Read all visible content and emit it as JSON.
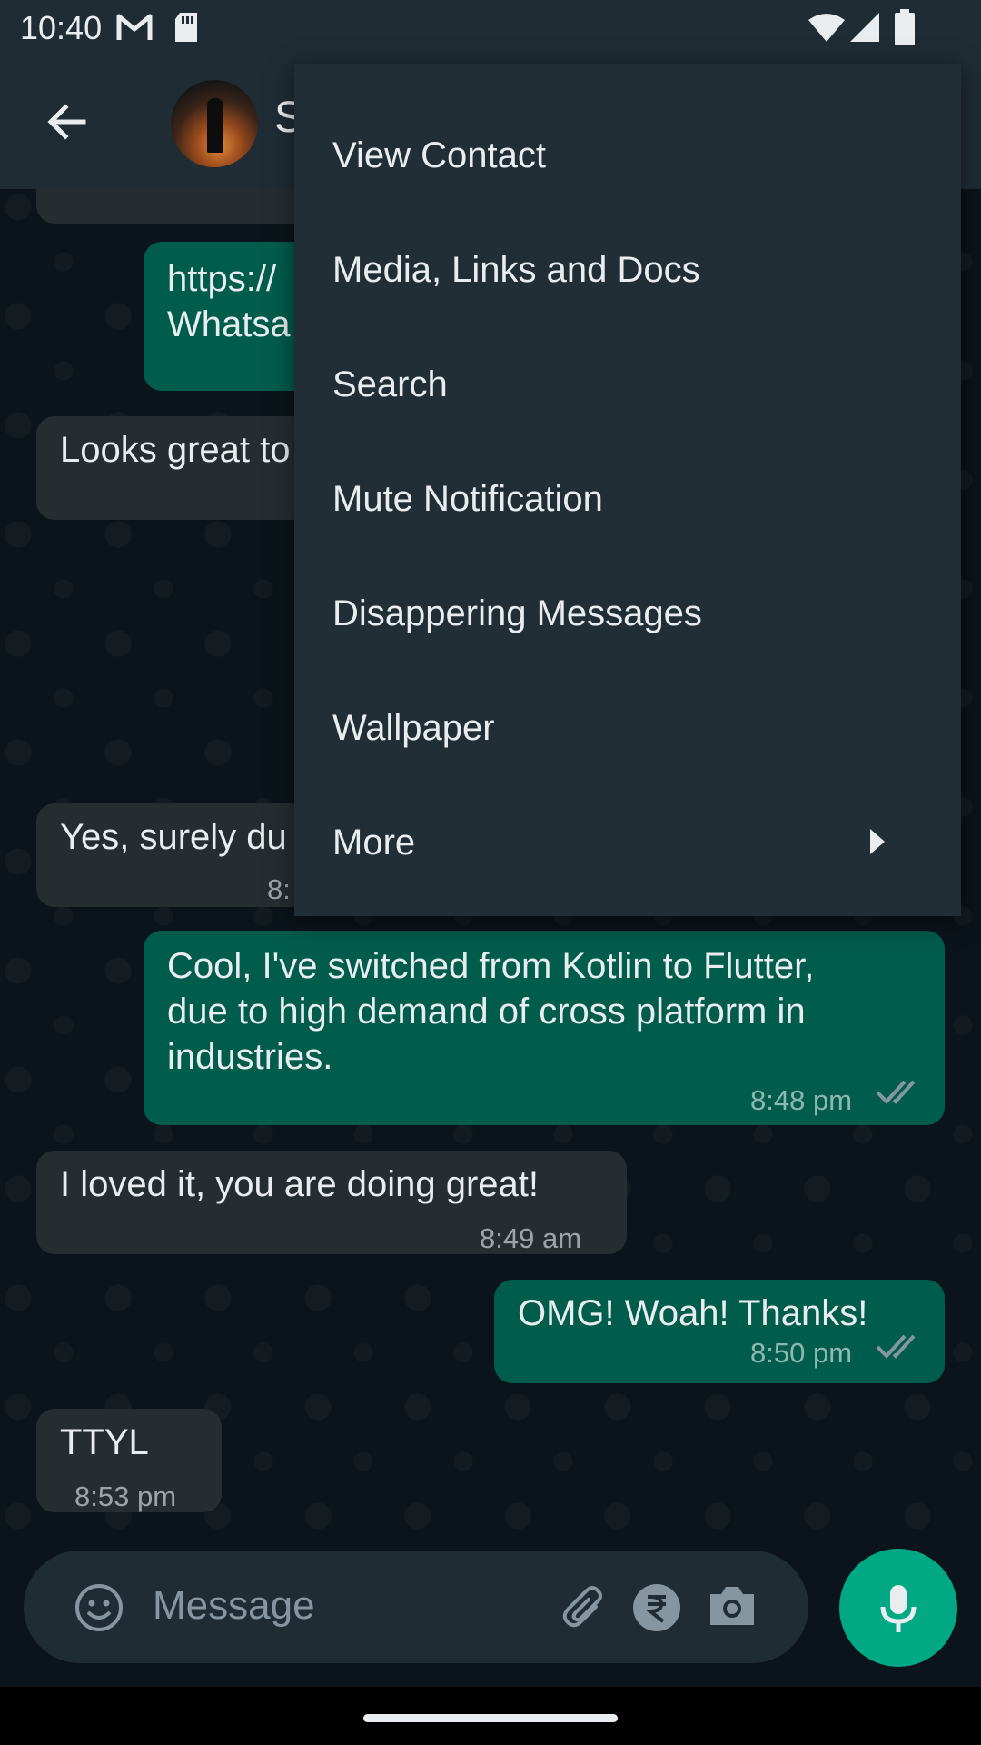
{
  "status_bar": {
    "time": "10:40"
  },
  "header": {
    "contact_name": "S"
  },
  "messages": [
    {
      "text": "https://",
      "text2": "Whatsa"
    },
    {
      "text": "Looks great to"
    },
    {
      "text": "Yes, surely du",
      "time": "8:"
    },
    {
      "text": "Cool, I've switched from Kotlin to Flutter,",
      "text2": "due to high demand of cross platform in",
      "text3": "industries.",
      "time": "8:48 pm"
    },
    {
      "text": "I loved it, you are doing great!",
      "time": "8:49 am"
    },
    {
      "text": "OMG! Woah! Thanks!",
      "time": "8:50 pm"
    },
    {
      "text": "TTYL",
      "time": "8:53 pm"
    }
  ],
  "menu": {
    "items": [
      {
        "label": "View Contact"
      },
      {
        "label": "Media, Links and Docs"
      },
      {
        "label": "Search"
      },
      {
        "label": "Mute Notification"
      },
      {
        "label": "Disappering Messages"
      },
      {
        "label": "Wallpaper"
      },
      {
        "label": "More"
      }
    ]
  },
  "composer": {
    "placeholder": "Message"
  },
  "colors": {
    "outgoing_bubble": "#005c4b",
    "incoming_bubble": "#262d31",
    "accent": "#00a884",
    "menu_bg": "#222e35"
  }
}
